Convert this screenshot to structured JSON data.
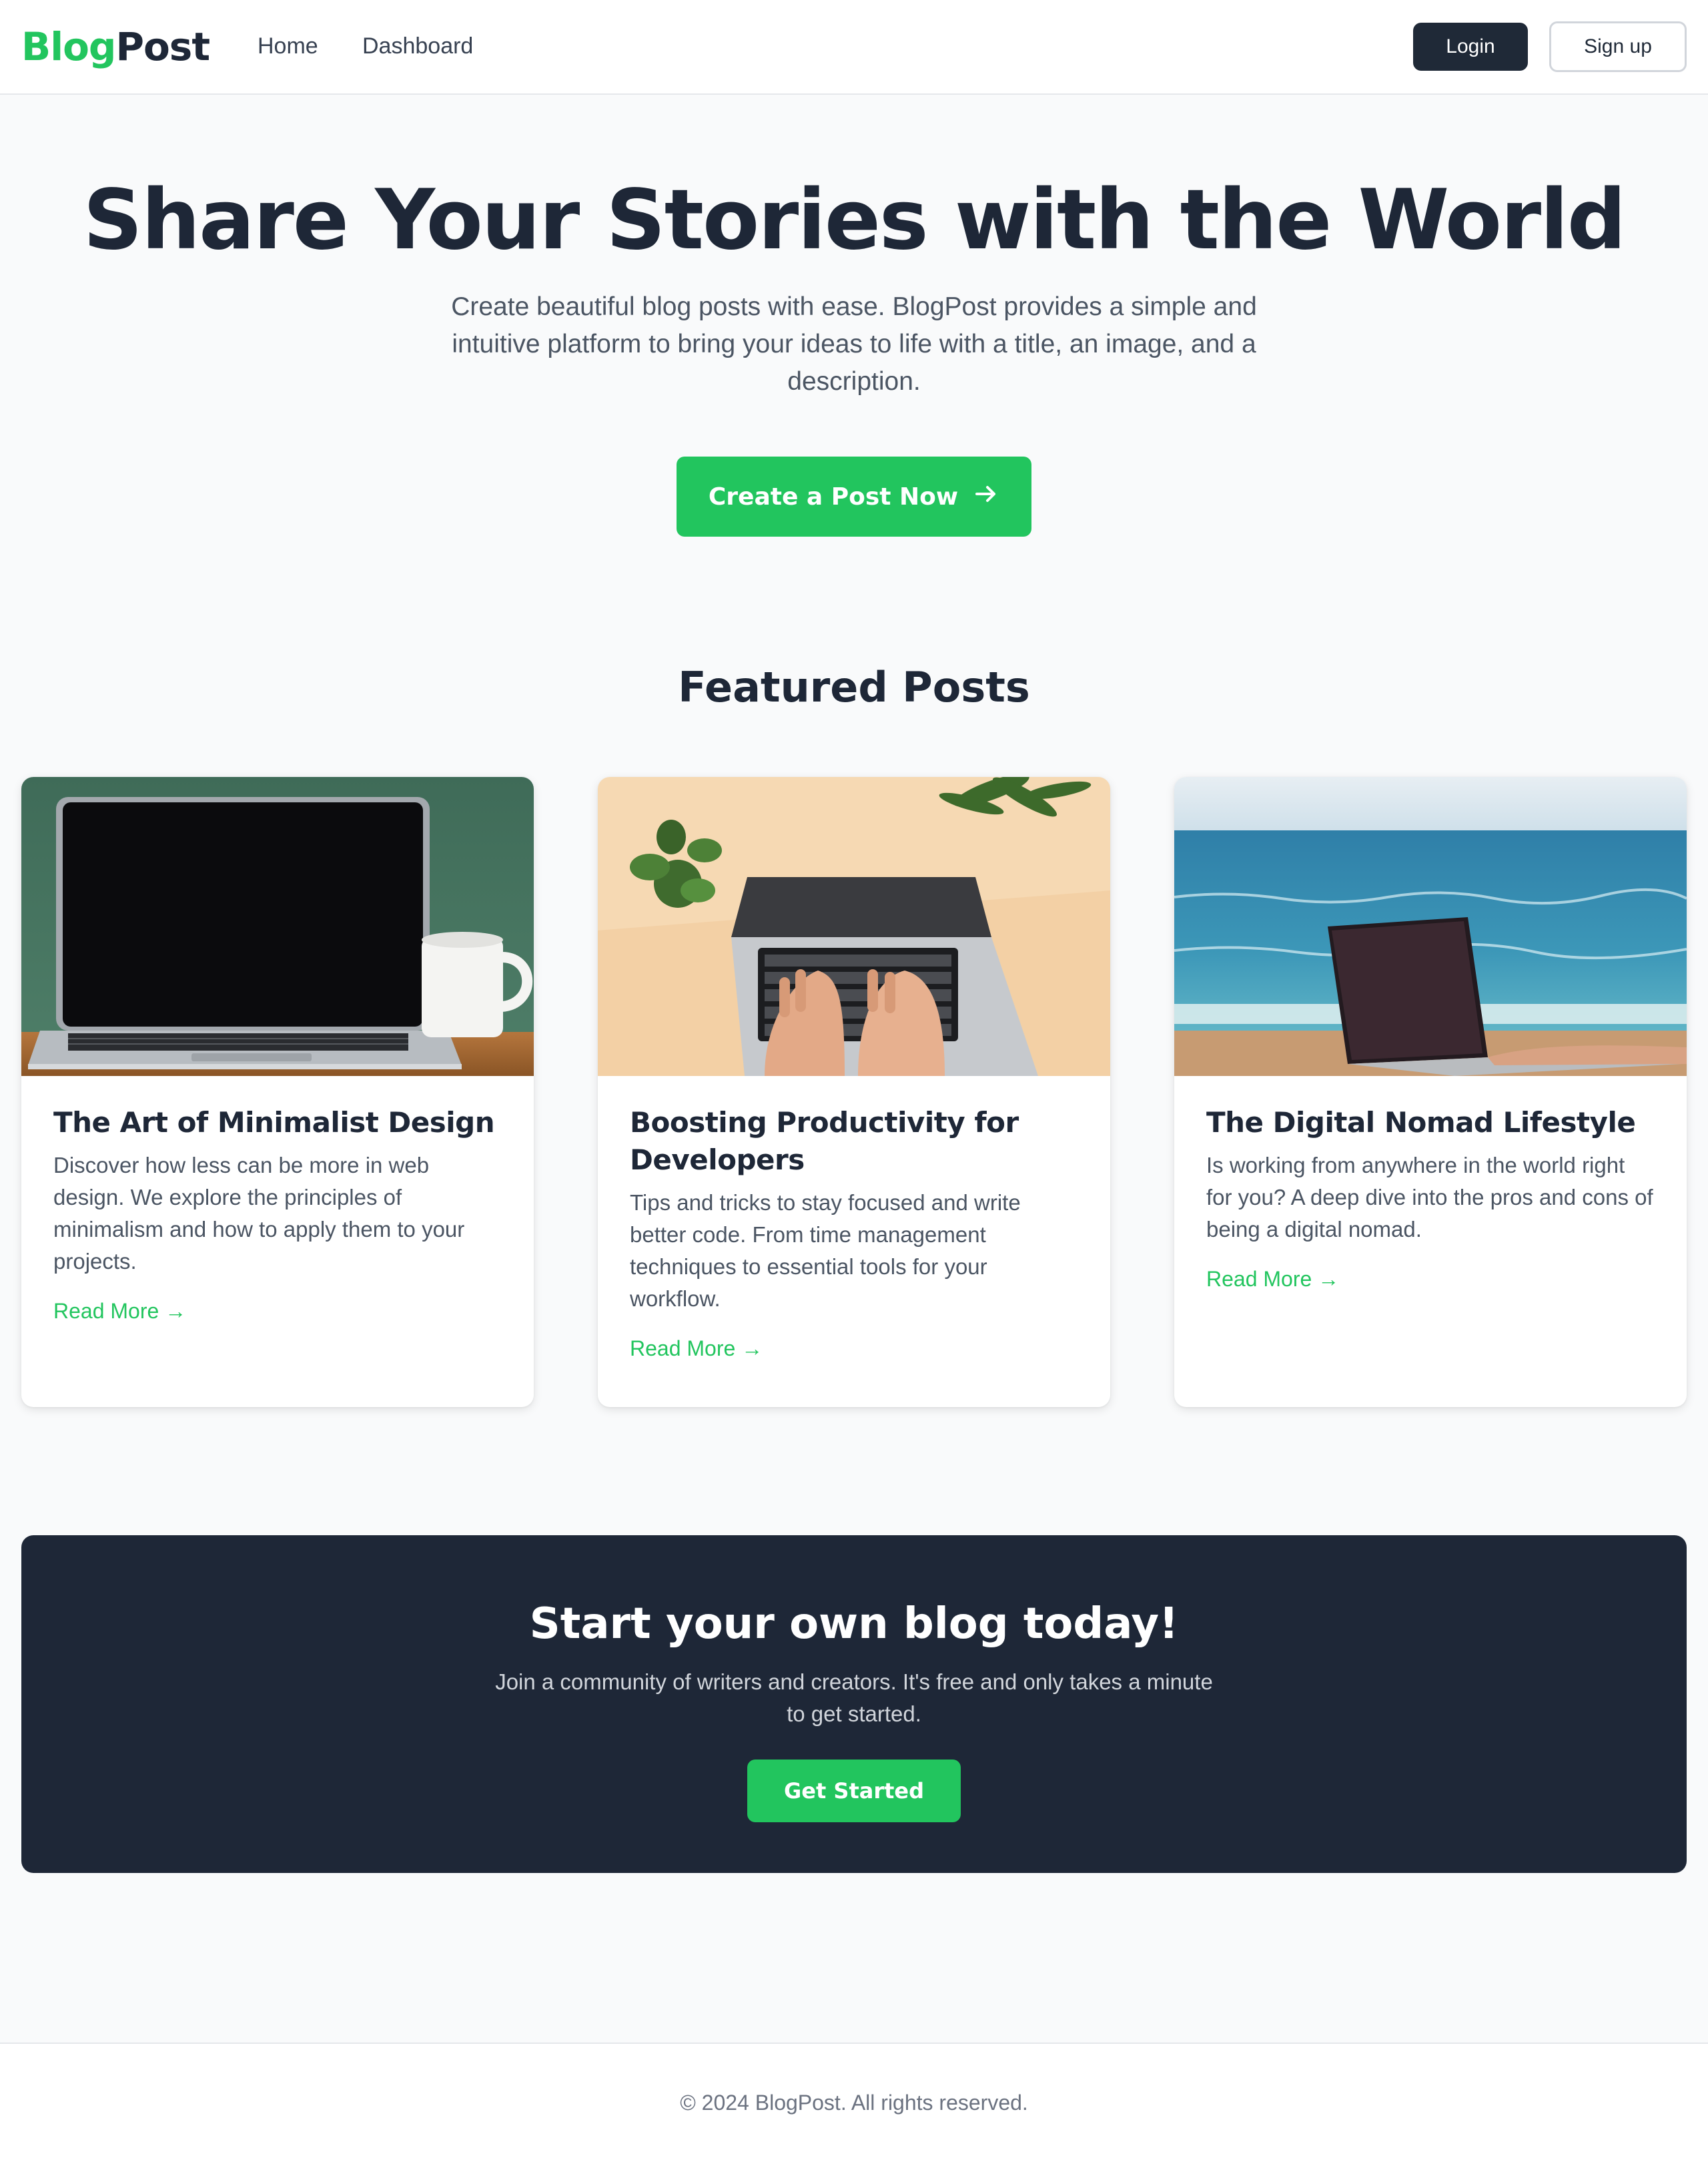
{
  "header": {
    "logo_part1": "Blog",
    "logo_part2": "Post",
    "nav": [
      {
        "label": "Home"
      },
      {
        "label": "Dashboard"
      }
    ],
    "login_label": "Login",
    "signup_label": "Sign up"
  },
  "hero": {
    "title": "Share Your Stories with the World",
    "subtitle": "Create beautiful blog posts with ease. BlogPost provides a simple and intuitive platform to bring your ideas to life with a title, an image, and a description.",
    "cta_label": "Create a Post Now",
    "cta_icon": "arrow-right-icon"
  },
  "featured": {
    "title": "Featured Posts",
    "posts": [
      {
        "title": "The Art of Minimalist Design",
        "description": "Discover how less can be more in web design. We explore the principles of minimalism and how to apply them to your projects.",
        "read_more": "Read More →",
        "image": "laptop-with-coffee-mug-photo"
      },
      {
        "title": "Boosting Productivity for Developers",
        "description": "Tips and tricks to stay focused and write better code. From time management techniques to essential tools for your workflow.",
        "read_more": "Read More →",
        "image": "hands-typing-on-laptop-photo"
      },
      {
        "title": "The Digital Nomad Lifestyle",
        "description": "Is working from anywhere in the world right for you? A deep dive into the pros and cons of being a digital nomad.",
        "read_more": "Read More →",
        "image": "laptop-at-beach-photo"
      }
    ]
  },
  "cta": {
    "title": "Start your own blog today!",
    "subtitle": "Join a community of writers and creators. It's free and only takes a minute to get started.",
    "button_label": "Get Started"
  },
  "footer": {
    "text": "© 2024 BlogPost. All rights reserved."
  },
  "colors": {
    "accent": "#22c55e",
    "dark": "#1e2737",
    "background": "#f9fafb"
  }
}
